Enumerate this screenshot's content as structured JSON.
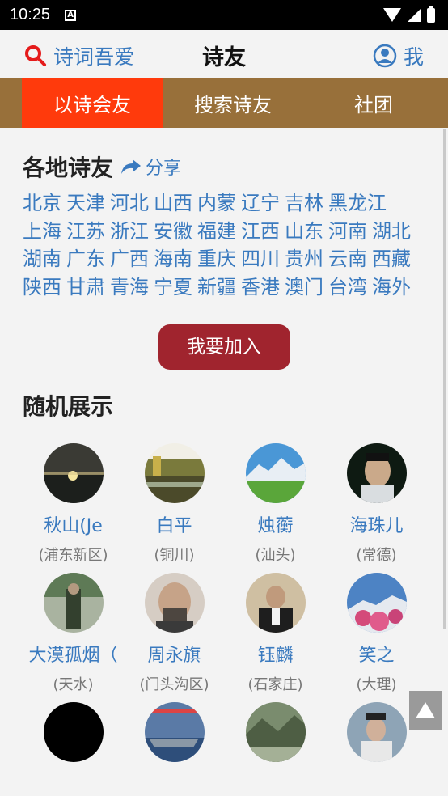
{
  "status": {
    "time": "10:25",
    "notification_glyph": "A"
  },
  "header": {
    "left_label": "诗词吾爱",
    "title": "诗友",
    "right_label": "我"
  },
  "tabs": [
    {
      "label": "以诗会友",
      "active": true
    },
    {
      "label": "搜索诗友",
      "active": false
    },
    {
      "label": "社团",
      "active": false
    }
  ],
  "regions_section": {
    "title": "各地诗友",
    "share_label": "分享",
    "regions": [
      "北京",
      "天津",
      "河北",
      "山西",
      "内蒙",
      "辽宁",
      "吉林",
      "黑龙江",
      "上海",
      "江苏",
      "浙江",
      "安徽",
      "福建",
      "江西",
      "山东",
      "河南",
      "湖北",
      "湖南",
      "广东",
      "广西",
      "海南",
      "重庆",
      "四川",
      "贵州",
      "云南",
      "西藏",
      "陕西",
      "甘肃",
      "青海",
      "宁夏",
      "新疆",
      "香港",
      "澳门",
      "台湾",
      "海外"
    ]
  },
  "join_button": "我要加入",
  "random_section": {
    "title": "随机展示",
    "users": [
      {
        "name": "秋山(Je",
        "location": "(浦东新区)"
      },
      {
        "name": "白平",
        "location": "(铜川)"
      },
      {
        "name": "烛蘅",
        "location": "(汕头)"
      },
      {
        "name": "海珠儿",
        "location": "(常德)"
      },
      {
        "name": "大漠孤烟（",
        "location": "(天水)"
      },
      {
        "name": "周永旗",
        "location": "(门头沟区)"
      },
      {
        "name": "钰麟",
        "location": "(石家庄)"
      },
      {
        "name": "笑之",
        "location": "(大理)"
      },
      {
        "name": "",
        "location": ""
      },
      {
        "name": "",
        "location": ""
      },
      {
        "name": "",
        "location": ""
      },
      {
        "name": "",
        "location": ""
      }
    ]
  },
  "colors": {
    "accent_blue": "#3a7abf",
    "tab_bar": "#98703a",
    "tab_active": "#ff3a0c",
    "join_button": "#a0242e"
  }
}
